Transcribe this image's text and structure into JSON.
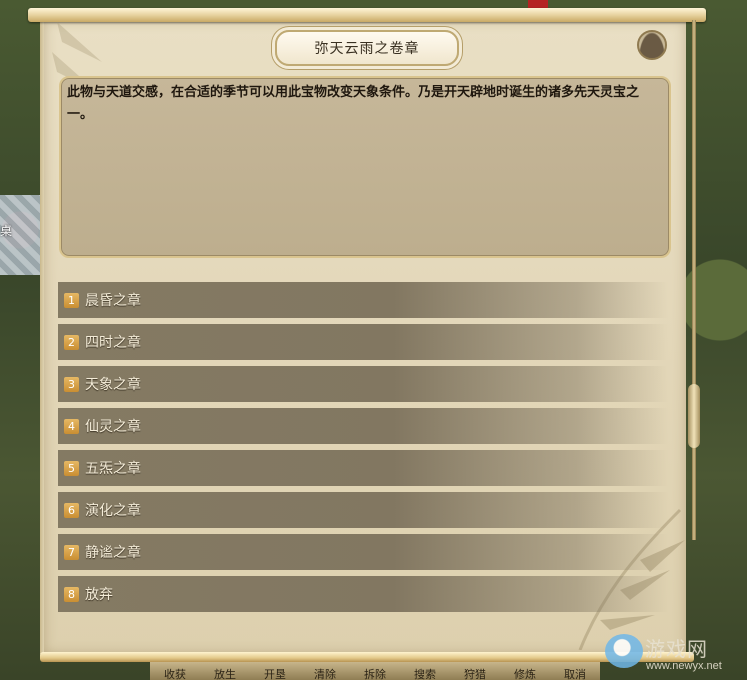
{
  "dialog": {
    "title": "弥天云雨之卷章",
    "avatar_icon": "user-avatar-icon",
    "description": "此物与天道交感，在合适的季节可以用此宝物改变天象条件。乃是开天辟地时诞生的诸多先天灵宝之一。"
  },
  "options": [
    {
      "num": "1",
      "label": "晨昏之章"
    },
    {
      "num": "2",
      "label": "四时之章"
    },
    {
      "num": "3",
      "label": "天象之章"
    },
    {
      "num": "4",
      "label": "仙灵之章"
    },
    {
      "num": "5",
      "label": "五炁之章"
    },
    {
      "num": "6",
      "label": "演化之章"
    },
    {
      "num": "7",
      "label": "静谧之章"
    },
    {
      "num": "8",
      "label": "放弃"
    }
  ],
  "scene": {
    "label": "桌"
  },
  "toolbar": {
    "items": [
      "收获",
      "放生",
      "开垦",
      "清除",
      "拆除",
      "搜索",
      "狩猎",
      "修炼",
      "取消"
    ]
  },
  "watermark": {
    "text": "游戏网",
    "url": "www.newyx.net"
  },
  "colors": {
    "panel": "#e3d7b9",
    "option_bar": "#847a63",
    "number_badge": "#d9a24a",
    "title_border": "#bfa973"
  }
}
